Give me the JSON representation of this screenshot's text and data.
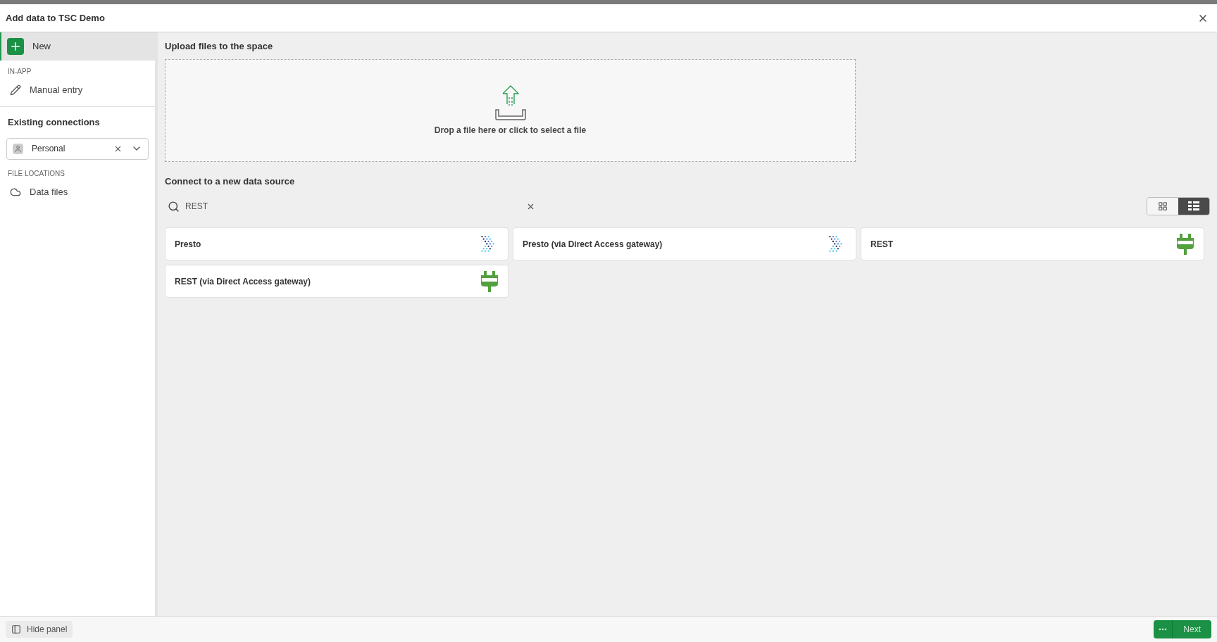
{
  "window": {
    "title": "Add data to TSC Demo"
  },
  "sidebar": {
    "new_item": {
      "label": "New",
      "selected": true
    },
    "in_app_heading": "IN-APP",
    "in_app_items": [
      {
        "label": "Manual entry",
        "kind": "pencil"
      }
    ],
    "existing_heading": "Existing connections",
    "space_select": {
      "value": "Personal"
    },
    "file_locations_heading": "FILE LOCATIONS",
    "file_items": [
      {
        "label": "Data files",
        "kind": "cloud"
      }
    ]
  },
  "upload": {
    "heading": "Upload files to the space",
    "drop_text": "Drop a file here or click to select a file"
  },
  "connect": {
    "heading": "Connect to a new data source",
    "search": {
      "value": "REST"
    },
    "view_toggle": [
      {
        "kind": "grid",
        "selected": false
      },
      {
        "kind": "list",
        "selected": true
      }
    ],
    "sources": [
      {
        "name": "Presto",
        "kind": "presto"
      },
      {
        "name": "Presto (via Direct Access gateway)",
        "kind": "presto"
      },
      {
        "name": "REST",
        "kind": "rest"
      },
      {
        "name": "REST (via Direct Access gateway)",
        "kind": "rest"
      }
    ]
  },
  "footer": {
    "hide_panel": "Hide panel",
    "next": "Next"
  }
}
